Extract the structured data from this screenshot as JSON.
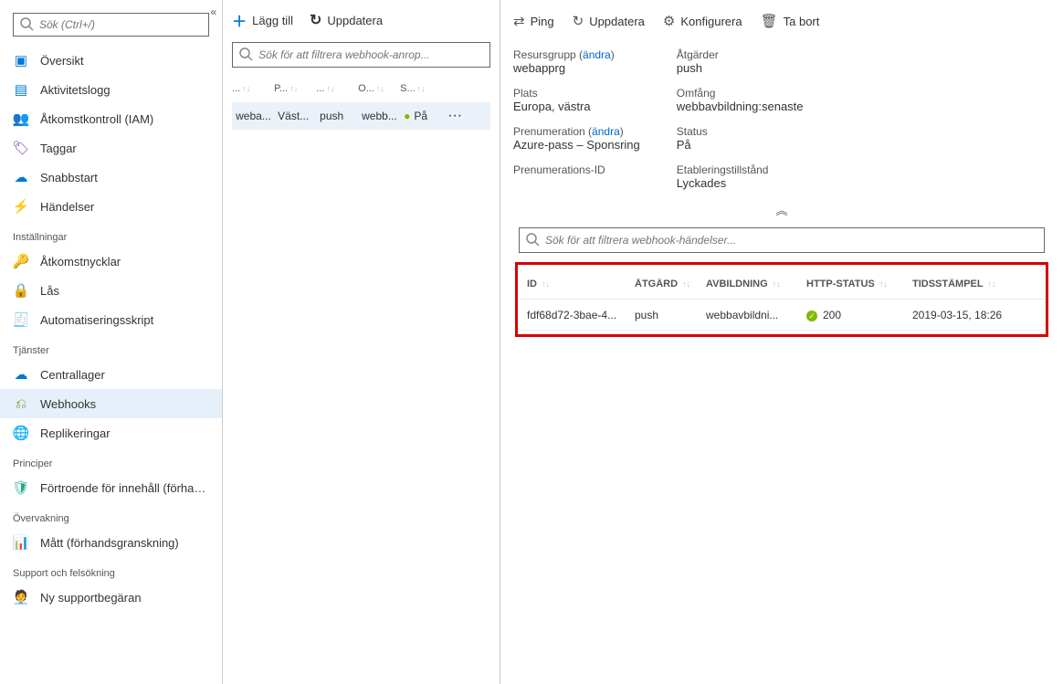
{
  "sidebar": {
    "search_placeholder": "Sök (Ctrl+/)",
    "items_top": [
      {
        "label": "Översikt",
        "icon": "overview"
      },
      {
        "label": "Aktivitetslogg",
        "icon": "log"
      },
      {
        "label": "Åtkomstkontroll (IAM)",
        "icon": "iam"
      },
      {
        "label": "Taggar",
        "icon": "tag"
      },
      {
        "label": "Snabbstart",
        "icon": "rocket"
      },
      {
        "label": "Händelser",
        "icon": "event"
      }
    ],
    "sections": [
      {
        "heading": "Inställningar",
        "items": [
          {
            "label": "Åtkomstnycklar",
            "icon": "key"
          },
          {
            "label": "Lås",
            "icon": "lock"
          },
          {
            "label": "Automatiseringsskript",
            "icon": "script"
          }
        ]
      },
      {
        "heading": "Tjänster",
        "items": [
          {
            "label": "Centrallager",
            "icon": "repo"
          },
          {
            "label": "Webhooks",
            "icon": "webhook",
            "selected": true
          },
          {
            "label": "Replikeringar",
            "icon": "repl"
          }
        ]
      },
      {
        "heading": "Principer",
        "items": [
          {
            "label": "Förtroende för innehåll (förhand...",
            "icon": "trust"
          }
        ]
      },
      {
        "heading": "Övervakning",
        "items": [
          {
            "label": "Mått (förhandsgranskning)",
            "icon": "metrics"
          }
        ]
      },
      {
        "heading": "Support och felsökning",
        "items": [
          {
            "label": "Ny supportbegäran",
            "icon": "support"
          }
        ]
      }
    ]
  },
  "middle": {
    "toolbar": {
      "add": "Lägg till",
      "refresh": "Uppdatera"
    },
    "filter_placeholder": "Sök för att filtrera webhook-anrop...",
    "columns": [
      "...",
      "P...",
      "...",
      "O...",
      "S..."
    ],
    "row": {
      "c0": "weba...",
      "c1": "Väst...",
      "c2": "push",
      "c3": "webb...",
      "c4": "På"
    }
  },
  "detail": {
    "toolbar": {
      "ping": "Ping",
      "refresh": "Uppdatera",
      "configure": "Konfigurera",
      "delete": "Ta bort"
    },
    "props": {
      "left": [
        {
          "label": "Resursgrupp (",
          "link": "ändra",
          "after": ")",
          "value": "webapprg",
          "value_is_link": true
        },
        {
          "label": "Plats",
          "value": "Europa, västra"
        },
        {
          "label": "Prenumeration (",
          "link": "ändra",
          "after": ")",
          "value": "Azure-pass – Sponsring",
          "value_is_link": true
        },
        {
          "label": "Prenumerations-ID",
          "value": ""
        }
      ],
      "right": [
        {
          "label": "Åtgärder",
          "value": "push"
        },
        {
          "label": "Omfång",
          "value": "webbavbildning:senaste"
        },
        {
          "label": "Status",
          "value": "På"
        },
        {
          "label": "Etableringstillstånd",
          "value": "Lyckades"
        }
      ]
    },
    "events": {
      "filter_placeholder": "Sök för att filtrera webhook-händelser...",
      "columns": {
        "id": "ID",
        "action": "ÅTGÄRD",
        "image": "AVBILDNING",
        "http": "HTTP-STATUS",
        "ts": "TIDSSTÄMPEL"
      },
      "rows": [
        {
          "id": "fdf68d72-3bae-4...",
          "action": "push",
          "image": "webbavbildni...",
          "http": "200",
          "ts": "2019-03-15, 18:26"
        }
      ]
    }
  }
}
